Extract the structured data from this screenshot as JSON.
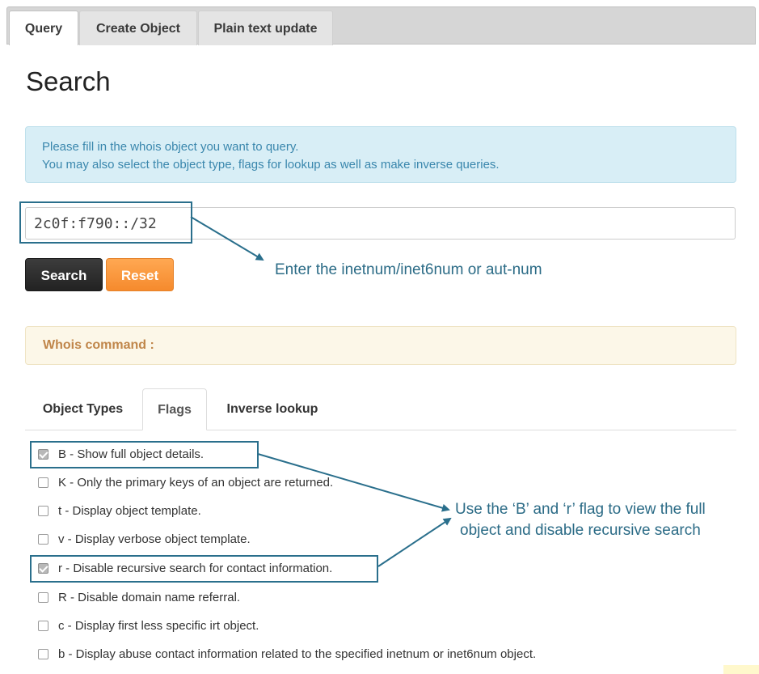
{
  "top_tabs": [
    {
      "label": "Query",
      "active": true
    },
    {
      "label": "Create Object",
      "active": false
    },
    {
      "label": "Plain text update",
      "active": false
    }
  ],
  "page_title": "Search",
  "info": {
    "line1": "Please fill in the whois object you want to query.",
    "line2": "You may also select the object type, flags for lookup as well as make inverse queries."
  },
  "search": {
    "value": "2c0f:f790::/32"
  },
  "buttons": {
    "search": "Search",
    "reset": "Reset"
  },
  "annotations": {
    "enter_hint": "Enter the inetnum/inet6num or aut-num",
    "flag_hint_line1": "Use the ‘B’ and ‘r’ flag to view the full",
    "flag_hint_line2": "object and disable recursive search"
  },
  "whois_command": {
    "label": "Whois command :"
  },
  "sub_tabs": [
    {
      "label": "Object Types",
      "active": false
    },
    {
      "label": "Flags",
      "active": true
    },
    {
      "label": "Inverse lookup",
      "active": false
    }
  ],
  "flags": [
    {
      "label": "B - Show full object details.",
      "checked": true
    },
    {
      "label": "K - Only the primary keys of an object are returned.",
      "checked": false
    },
    {
      "label": "t - Display object template.",
      "checked": false
    },
    {
      "label": "v - Display verbose object template.",
      "checked": false
    },
    {
      "label": "r - Disable recursive search for contact information.",
      "checked": true
    },
    {
      "label": "R - Disable domain name referral.",
      "checked": false
    },
    {
      "label": "c - Display first less specific irt object.",
      "checked": false
    },
    {
      "label": "b - Display abuse contact information related to the specified inetnum or inet6num object.",
      "checked": false
    }
  ],
  "colors": {
    "annotation": "#2b6b86",
    "accent_orange": "#f58a2d",
    "info_blue": "#3a87ad"
  }
}
